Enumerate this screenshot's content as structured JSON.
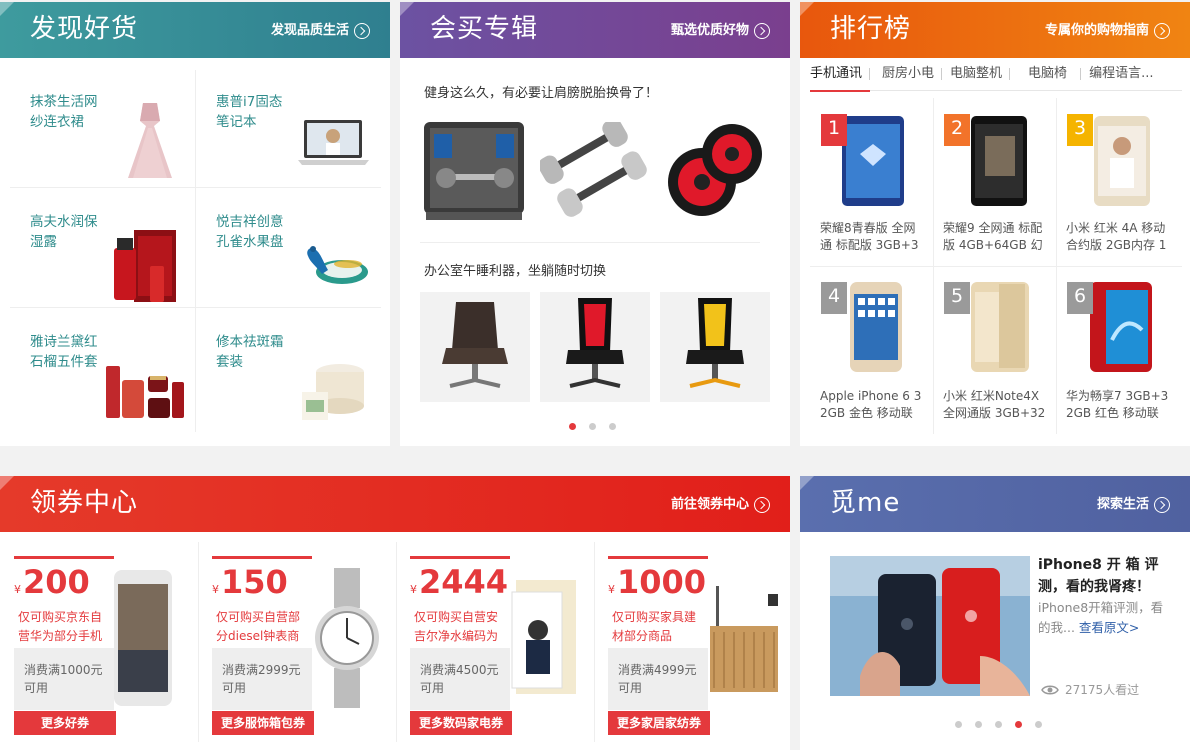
{
  "discover": {
    "title": "发现好货",
    "more": "发现品质生活",
    "items": [
      {
        "line1": "抹茶生活网",
        "line2": "纱连衣裙"
      },
      {
        "line1": "惠普i7固态",
        "line2": "笔记本"
      },
      {
        "line1": "高夫水润保",
        "line2": "湿露"
      },
      {
        "line1": "悦吉祥创意",
        "line2": "孔雀水果盘"
      },
      {
        "line1": "雅诗兰黛红",
        "line2": "石榴五件套"
      },
      {
        "line1": "修本祛斑霜",
        "line2": "套装"
      }
    ]
  },
  "topics": {
    "title": "会买专辑",
    "more": "甄选优质好物",
    "line1": "健身这么久，有必要让肩膀脱胎换骨了！",
    "line2": "办公室午睡利器，坐躺随时切换"
  },
  "ranking": {
    "title": "排行榜",
    "more": "专属你的购物指南",
    "tabs": [
      "手机通讯",
      "厨房小电",
      "电脑整机",
      "电脑椅",
      "编程语言..."
    ],
    "items": [
      {
        "rank": "1",
        "line1": "荣耀8青春版 全网",
        "line2": "通 标配版 3GB+3"
      },
      {
        "rank": "2",
        "line1": "荣耀9 全网通 标配",
        "line2": "版 4GB+64GB 幻"
      },
      {
        "rank": "3",
        "line1": "小米 红米 4A 移动",
        "line2": "合约版 2GB内存 1"
      },
      {
        "rank": "4",
        "line1": "Apple iPhone 6 3",
        "line2": "2GB 金色 移动联"
      },
      {
        "rank": "5",
        "line1": "小米 红米Note4X",
        "line2": "全网通版 3GB+32"
      },
      {
        "rank": "6",
        "line1": "华为畅享7 3GB+3",
        "line2": "2GB 红色 移动联"
      }
    ],
    "colors": {
      "rank1": "#e4393c",
      "rank2": "#f2732a",
      "rank3": "#f5b400",
      "rankOther": "#9a9a9a"
    }
  },
  "coupons": {
    "title": "领券中心",
    "more": "前往领券中心",
    "currency": "¥",
    "items": [
      {
        "amount": "200",
        "line1": "仅可购买京东自",
        "line2": "营华为部分手机",
        "cond1": "消费满1000元",
        "cond2": "可用",
        "button": "更多好券"
      },
      {
        "amount": "150",
        "line1": "仅可购买自营部",
        "line2": "分diesel钟表商品",
        "cond1": "消费满2999元",
        "cond2": "可用",
        "button": "更多服饰箱包券"
      },
      {
        "amount": "2444",
        "line1": "仅可购买自营安",
        "line2": "吉尔净水编码为",
        "cond1": "消费满4500元",
        "cond2": "可用",
        "button": "更多数码家电券"
      },
      {
        "amount": "1000",
        "line1": "仅可购买家具建",
        "line2": "材部分商品",
        "cond1": "消费满4999元",
        "cond2": "可用",
        "button": "更多家居家纺券"
      }
    ]
  },
  "findme": {
    "title": "觅me",
    "more": "探索生活",
    "article_title1": "iPhone8 开 箱 评",
    "article_title2": "测，看的我肾疼！",
    "summary1": "iPhone8开箱评测，看",
    "summary2": "的我...",
    "read_more": "查看原文>",
    "views": "27175人看过"
  },
  "colors": {
    "accent": "#e4393c",
    "teal": "#2f8c8c"
  }
}
